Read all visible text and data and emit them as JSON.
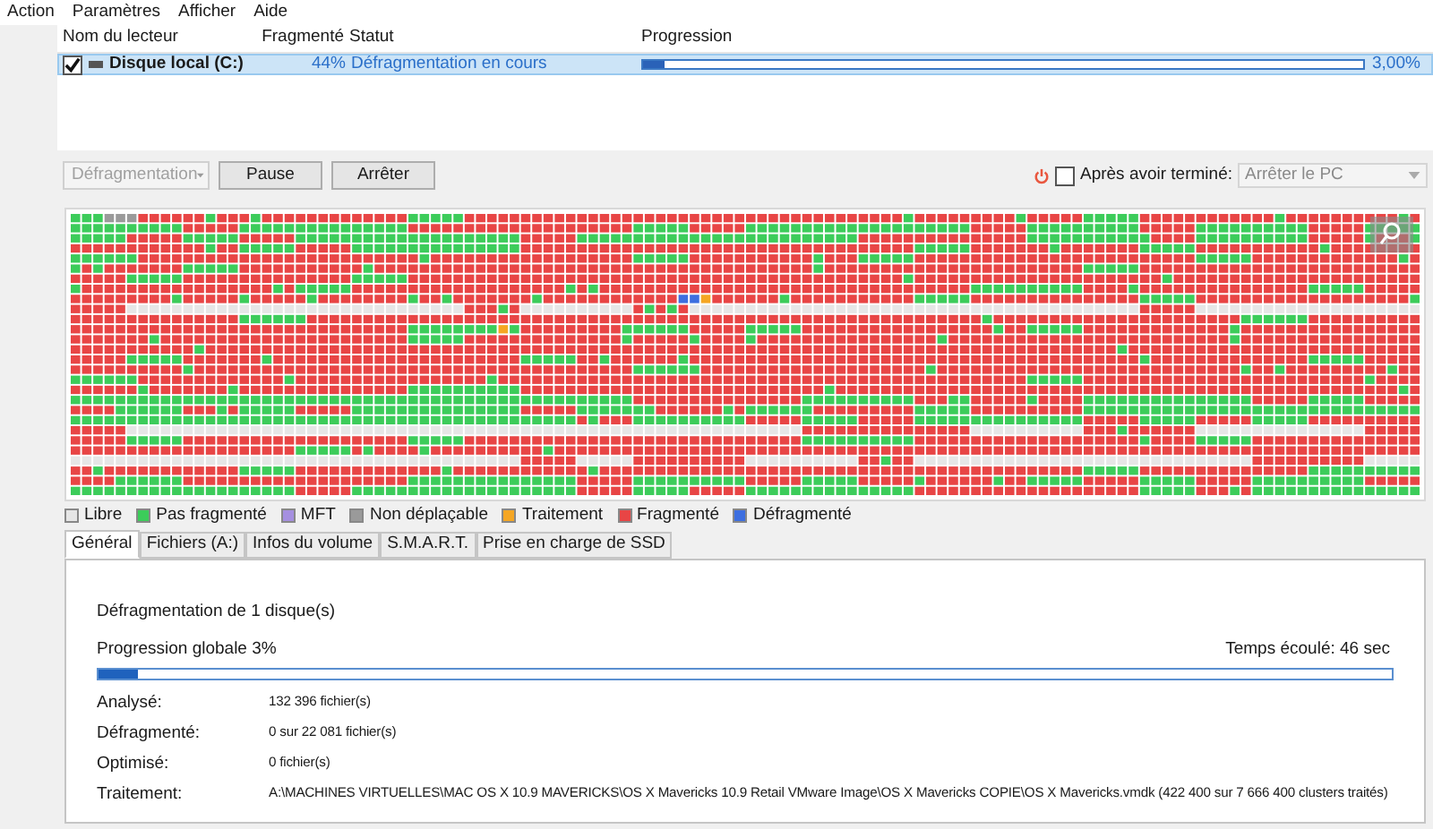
{
  "menu": [
    "Action",
    "Paramètres",
    "Afficher",
    "Aide"
  ],
  "drive_list": {
    "columns": [
      "Nom du lecteur",
      "Fragmenté",
      "Statut",
      "Progression"
    ],
    "rows": [
      {
        "name": "Disque local (C:)",
        "checked": true,
        "selected": true,
        "fragmented": "44%",
        "status": "Défragmentation en cours",
        "level": 0.03,
        "reading": "3,00%"
      }
    ]
  },
  "toolbar": {
    "defrag_button": {
      "label": "Défragmentation",
      "disabled": true
    },
    "buttons": [
      "Pause",
      "Arrêter"
    ],
    "after_finish": {
      "label": "Après avoir terminé:",
      "checked": false
    },
    "after_action": {
      "value": "Arrêter le PC",
      "disabled": true
    }
  },
  "legend": [
    {
      "label": "Libre",
      "color": "#e6e6e6"
    },
    {
      "label": "Pas fragmenté",
      "color": "#3ccc5a"
    },
    {
      "label": "MFT",
      "color": "#a58fe0"
    },
    {
      "label": "Non déplaçable",
      "color": "#9a9a9a"
    },
    {
      "label": "Traitement",
      "color": "#f5a623"
    },
    {
      "label": "Fragmenté",
      "color": "#e84545"
    },
    {
      "label": "Défragmenté",
      "color": "#3d6fe0"
    }
  ],
  "tabs": [
    {
      "label": "Général",
      "selected": true
    },
    {
      "label": "Fichiers (A:)",
      "selected": false
    },
    {
      "label": "Infos du volume",
      "selected": false
    },
    {
      "label": "S.M.A.R.T.",
      "selected": false
    },
    {
      "label": "Prise en charge de SSD",
      "selected": false
    }
  ],
  "general": {
    "title": "Défragmentation de 1 disque(s)",
    "progress_label": "Progression globale 3%",
    "elapsed": "Temps écoulé: 46 sec",
    "level": 0.03,
    "stats": [
      {
        "label": "Analysé:",
        "value": "132 396 fichier(s)"
      },
      {
        "label": "Défragmenté:",
        "value": "0 sur 22 081 fichier(s)"
      },
      {
        "label": "Optimisé:",
        "value": "0 fichier(s)"
      },
      {
        "label": "Traitement:",
        "value": "A:\\MACHINES VIRTUELLES\\MAC OS X 10.9 MAVERICKS\\OS X Mavericks 10.9 Retail VMware Image\\OS X Mavericks COPIE\\OS X Mavericks.vmdk (422 400 sur 7 666 400 clusters traités)"
      }
    ]
  }
}
